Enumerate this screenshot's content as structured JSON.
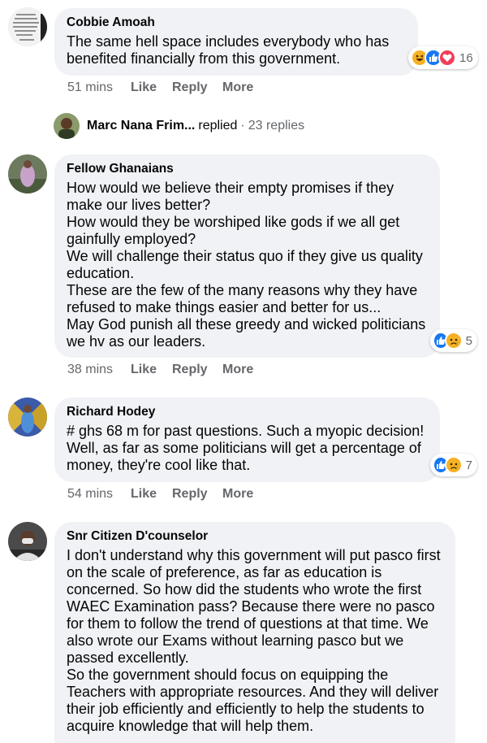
{
  "comments": [
    {
      "author": "Cobbie Amoah",
      "text": "The same hell space includes everybody who has benefited financially from this government.",
      "time": "51 mins",
      "reaction_count": "16",
      "reactions": [
        "haha-icon",
        "like-icon",
        "love-icon"
      ]
    },
    {
      "author": "Fellow Ghanaians",
      "text": "How would we believe their empty promises if they make our lives better?\nHow would they be worshiped like gods if we all get gainfully employed?\nWe will challenge their status quo if they give us quality education.\nThese are the few of the many reasons why they have refused to make things easier and better for us...\nMay God punish all these greedy and wicked politicians we hv as our leaders.",
      "time": "38 mins",
      "reaction_count": "5",
      "reactions": [
        "like-icon",
        "sad-icon"
      ]
    },
    {
      "author": "Richard Hodey",
      "text": "# ghs 68 m for past questions. Such a myopic decision! Well, as far as some politicians will get a percentage of money, they're cool like that.",
      "time": "54 mins",
      "reaction_count": "7",
      "reactions": [
        "like-icon",
        "sad-icon"
      ]
    },
    {
      "author": "Snr Citizen D'counselor",
      "text": "I don't understand why this government will put pasco first on the scale of preference, as far as education is concerned. So how did the students who wrote the first WAEC Examination pass? Because there were no pasco for them to follow the trend of questions at that time. We also wrote our Exams without learning pasco but we passed excellently.\nSo the government should focus on equipping the Teachers with appropriate resources. And they will deliver their job efficiently and efficiently to help the students to acquire knowledge that will help them."
    }
  ],
  "actions": {
    "like": "Like",
    "reply": "Reply",
    "more": "More"
  },
  "replied": {
    "name": "Marc Nana Frim...",
    "verb": "replied",
    "separator": "·",
    "count": "23 replies"
  },
  "colors": {
    "bubble": "#f0f2f5",
    "meta_text": "#65676b",
    "like_blue": "#1877f2",
    "love_red": "#f33e58",
    "emoji_yellow": "#f7b125"
  }
}
